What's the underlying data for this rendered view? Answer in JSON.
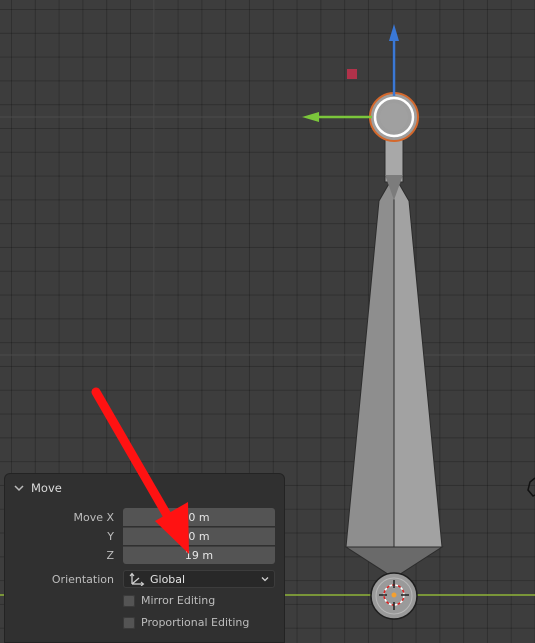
{
  "colors": {
    "viewport_bg": "#3d3d3d",
    "z_axis": "#3a78d6",
    "y_axis": "#7bc63b",
    "x_axis": "#b8e04a",
    "selection": "#d4682c",
    "annotation_arrow": "#ff1212",
    "panel_bg": "#303030"
  },
  "operator_panel": {
    "title": "Move",
    "collapse_icon": "chevron-down-icon",
    "move_x_label": "Move X",
    "move_y_label": "Y",
    "move_z_label": "Z",
    "move_x_value": "0 m",
    "move_y_value": "0 m",
    "move_z_value": "19 m",
    "orientation_label": "Orientation",
    "orientation_icon": "orientation-axes-icon",
    "orientation_value": "Global",
    "mirror_editing_label": "Mirror Editing",
    "mirror_editing_checked": false,
    "proportional_editing_label": "Proportional Editing",
    "proportional_editing_checked": false
  },
  "scene": {
    "gizmo_icons": [
      "z-axis-arrow-icon",
      "y-axis-arrow-icon",
      "xy-plane-handle-icon",
      "move-center-icon"
    ],
    "objects": [
      "bone-head",
      "bone-body",
      "bone-tail",
      "3d-cursor-icon",
      "light-object-icon"
    ],
    "annotation": "red-pointer-arrow"
  }
}
